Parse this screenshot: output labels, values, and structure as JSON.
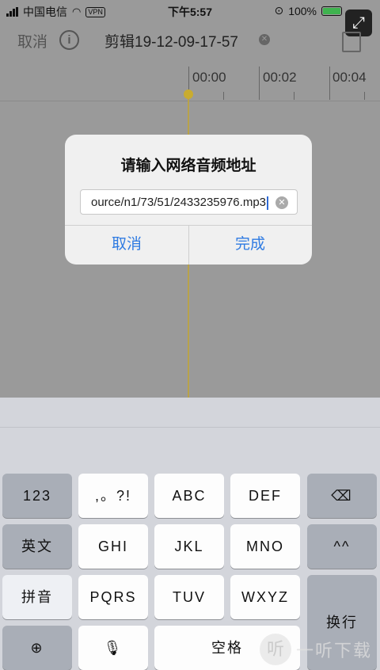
{
  "status_bar": {
    "carrier": "中国电信",
    "vpn_label": "VPN",
    "time": "下午5:57",
    "battery_percent": "100%"
  },
  "header": {
    "cancel_label": "取消",
    "info_icon": "i",
    "title": "剪辑19-12-09-17-57"
  },
  "timeline": {
    "ticks": [
      "00:00",
      "00:02",
      "00:04"
    ]
  },
  "dialog": {
    "title": "请输入网络音频地址",
    "url_value": "ource/n1/73/51/2433235976.mp3",
    "cancel_label": "取消",
    "done_label": "完成"
  },
  "keyboard": {
    "row1": [
      "123",
      ",。?!",
      "ABC",
      "DEF"
    ],
    "row2": [
      "英文",
      "GHI",
      "JKL",
      "MNO",
      "^^"
    ],
    "row3": [
      "拼音",
      "PQRS",
      "TUV",
      "WXYZ"
    ],
    "return_label": "换行",
    "space_label": "空格"
  },
  "watermark": {
    "logo_char": "听",
    "text": "一听下载"
  }
}
